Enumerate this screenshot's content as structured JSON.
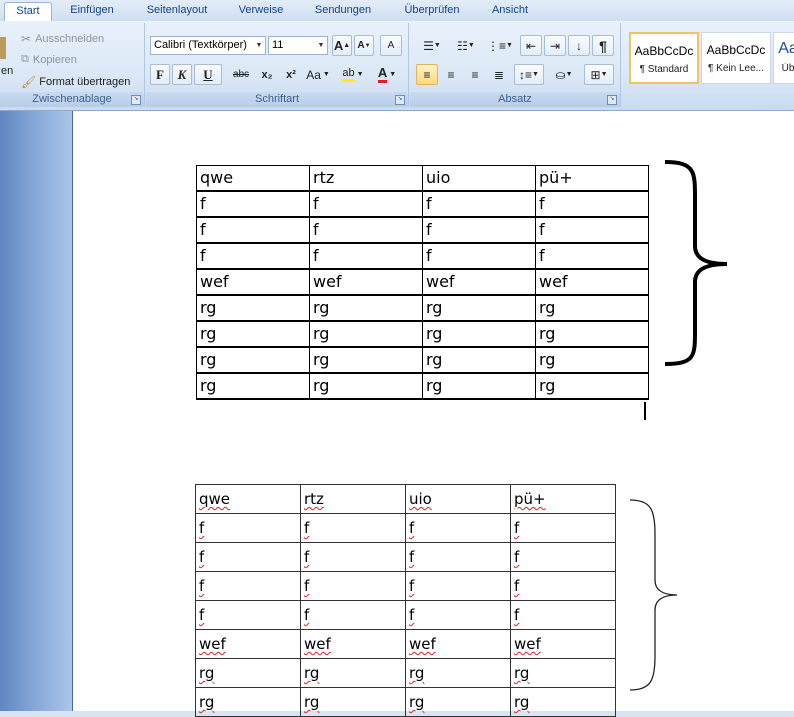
{
  "tabs": [
    "Start",
    "Einfügen",
    "Seitenlayout",
    "Verweise",
    "Sendungen",
    "Überprüfen",
    "Ansicht"
  ],
  "clipboard": {
    "paste_label": "en",
    "cut_label": "Ausschneiden",
    "copy_label": "Kopieren",
    "format_painter_label": "Format übertragen",
    "group_label": "Zwischenablage"
  },
  "font": {
    "family": "Calibri (Textkörper)",
    "size": "11",
    "grow": "A",
    "shrink": "A",
    "clear": "A",
    "bold": "F",
    "italic": "K",
    "underline": "U",
    "strike": "abc",
    "subscript": "x₂",
    "superscript": "x²",
    "case": "Aa",
    "highlight": "ab",
    "color": "A",
    "group_label": "Schriftart"
  },
  "paragraph": {
    "group_label": "Absatz",
    "pilcrow": "¶"
  },
  "styles": [
    {
      "sample": "AaBbCcDc",
      "name": "¶ Standard"
    },
    {
      "sample": "AaBbCcDc",
      "name": "¶ Kein Lee..."
    },
    {
      "sample": "Aa",
      "name": "Üb"
    }
  ],
  "table1": {
    "rows": [
      [
        "qwe",
        "rtz",
        "uio",
        "pü+"
      ],
      [
        "f",
        "f",
        "f",
        "f"
      ],
      [
        "f",
        "f",
        "f",
        "f"
      ],
      [
        "f",
        "f",
        "f",
        "f"
      ],
      [
        "wef",
        "wef",
        "wef",
        "wef"
      ],
      [
        "rg",
        "rg",
        "rg",
        "rg"
      ],
      [
        "rg",
        "rg",
        "rg",
        "rg"
      ],
      [
        "rg",
        "rg",
        "rg",
        "rg"
      ],
      [
        "rg",
        "rg",
        "rg",
        "rg"
      ]
    ]
  },
  "table2": {
    "rows": [
      [
        "qwe",
        "rtz",
        "uio",
        "pü+"
      ],
      [
        "f",
        "f",
        "f",
        "f"
      ],
      [
        "f",
        "f",
        "f",
        "f"
      ],
      [
        "f",
        "f",
        "f",
        "f"
      ],
      [
        "f",
        "f",
        "f",
        "f"
      ],
      [
        "wef",
        "wef",
        "wef",
        "wef"
      ],
      [
        "rg",
        "rg",
        "rg",
        "rg"
      ],
      [
        "rg",
        "rg",
        "rg",
        "rg"
      ]
    ]
  }
}
